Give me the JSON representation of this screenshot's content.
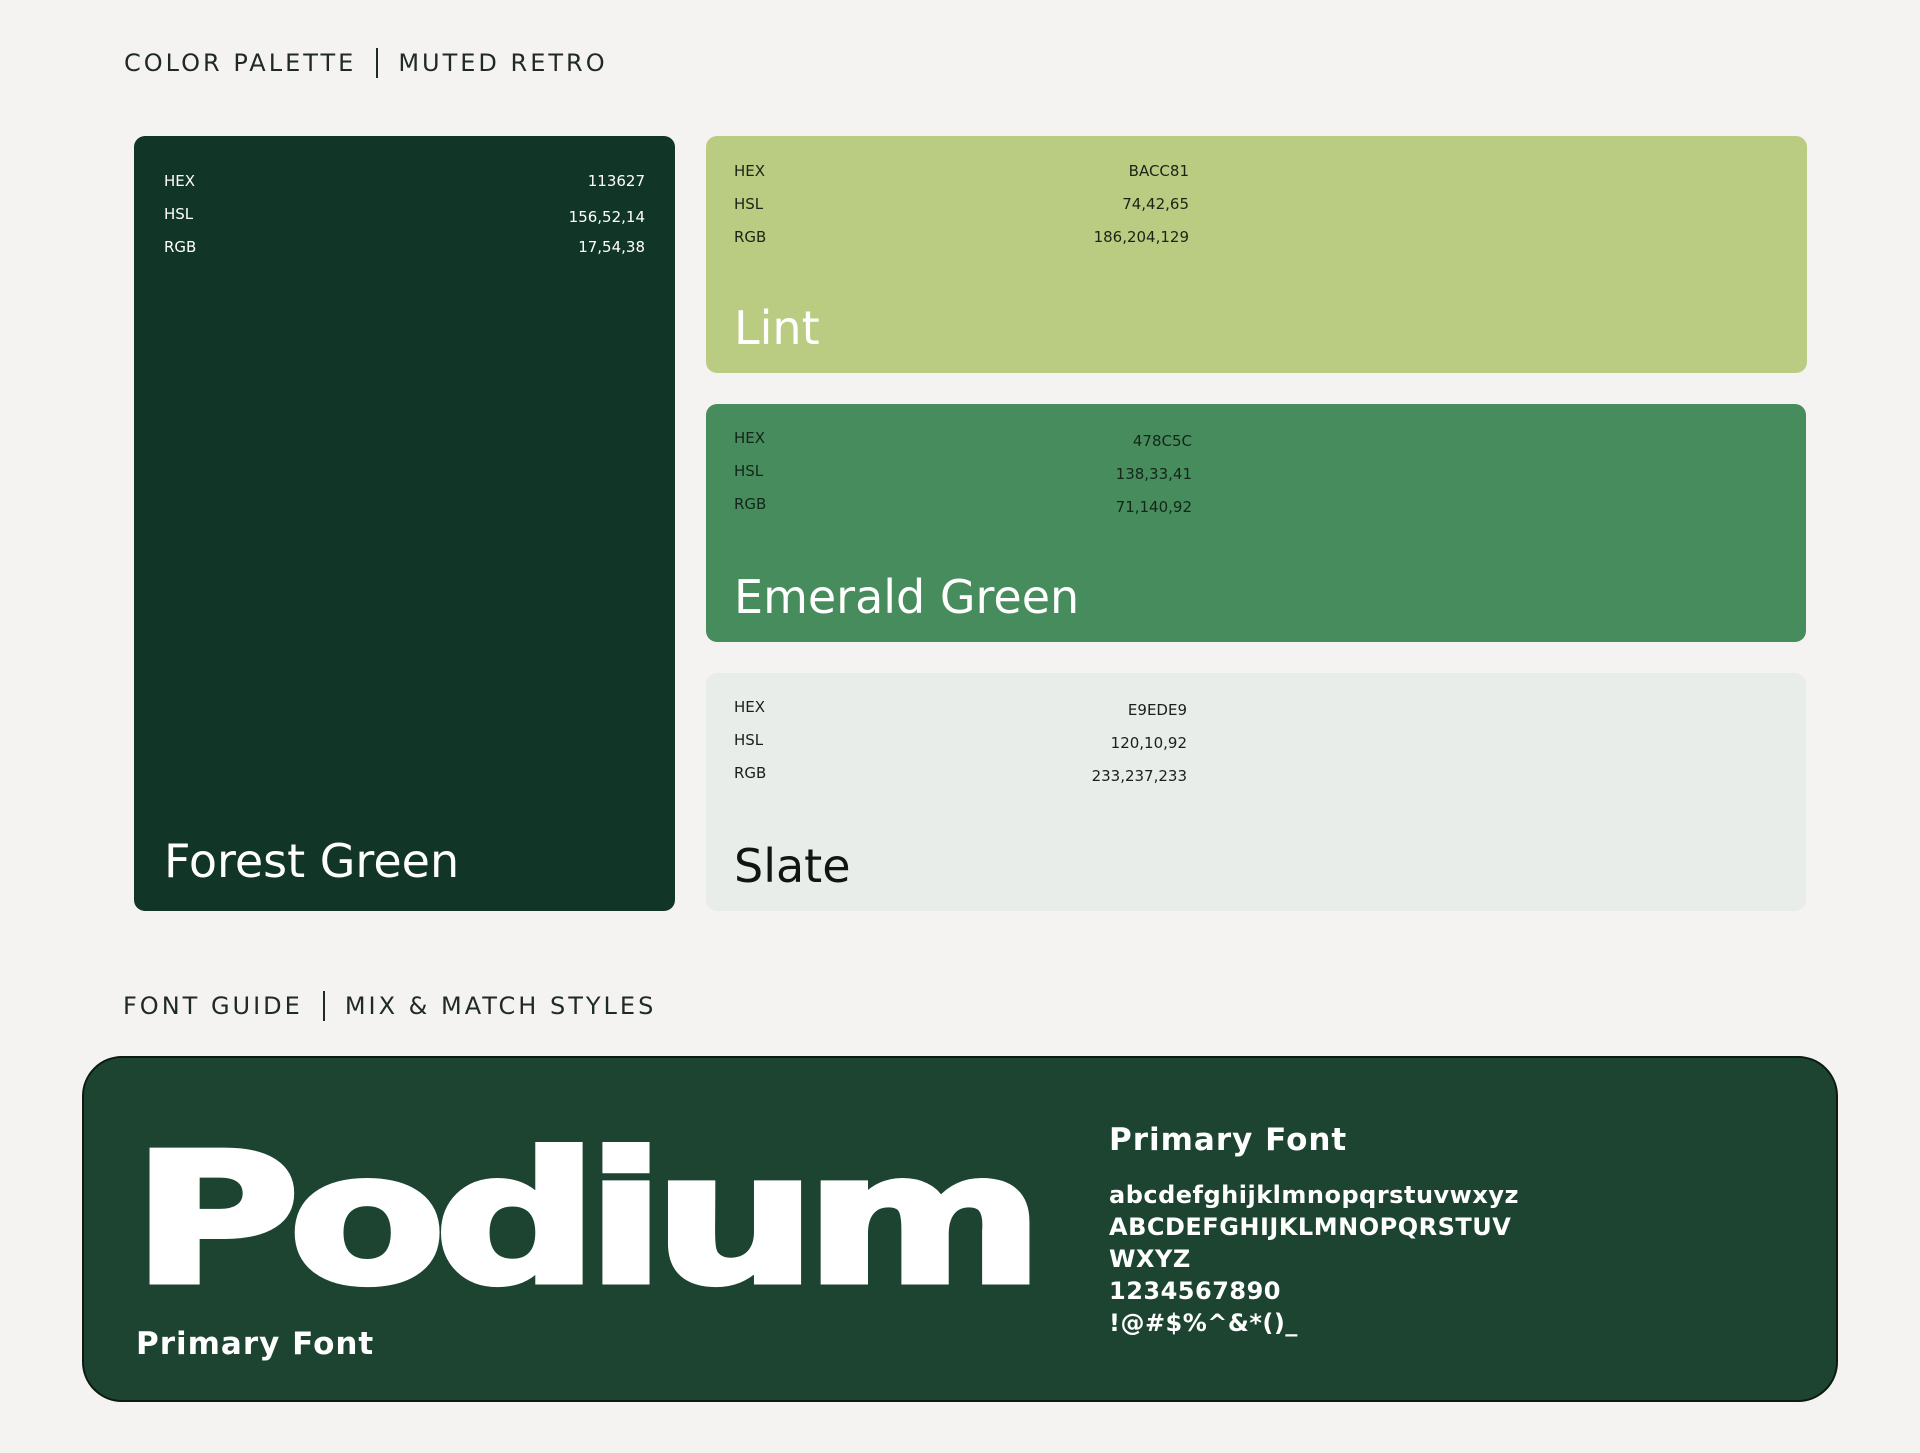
{
  "palette_section": {
    "title": "COLOR PALETTE",
    "subtitle": "MUTED RETRO"
  },
  "swatches": {
    "forest": {
      "name": "Forest Green",
      "hex_label": "HEX",
      "hex": "113627",
      "hsl_label": "HSL",
      "hsl": "156,52,14",
      "rgb_label": "RGB",
      "rgb": "17,54,38",
      "color": "#113627"
    },
    "lint": {
      "name": "Lint",
      "hex_label": "HEX",
      "hex": "BACC81",
      "hsl_label": "HSL",
      "hsl": "74,42,65",
      "rgb_label": "RGB",
      "rgb": "186,204,129",
      "color": "#BACC81"
    },
    "emerald": {
      "name": "Emerald Green",
      "hex_label": "HEX",
      "hex": "478C5C",
      "hsl_label": "HSL",
      "hsl": "138,33,41",
      "rgb_label": "RGB",
      "rgb": "71,140,92",
      "color": "#478C5C"
    },
    "slate": {
      "name": "Slate",
      "hex_label": "HEX",
      "hex": "E9EDE9",
      "hsl_label": "HSL",
      "hsl": "120,10,92",
      "rgb_label": "RGB",
      "rgb": "233,237,233",
      "color": "#E9EDE9"
    }
  },
  "font_section": {
    "title": "FONT GUIDE",
    "subtitle": "MIX & MATCH STYLES"
  },
  "font_card": {
    "sample": "Podium",
    "caption_left": "Primary Font",
    "caption_right": "Primary Font",
    "glyphs": {
      "lowercase": "abcdefghijklmnopqrstuvwxyz",
      "uppercase_1": "ABCDEFGHIJKLMNOPQRSTUV",
      "uppercase_2": "WXYZ",
      "digits": "1234567890",
      "symbols": "!@#$%^&*()_"
    },
    "background_color": "#1C4431"
  },
  "background_color": "#F4F3F1"
}
